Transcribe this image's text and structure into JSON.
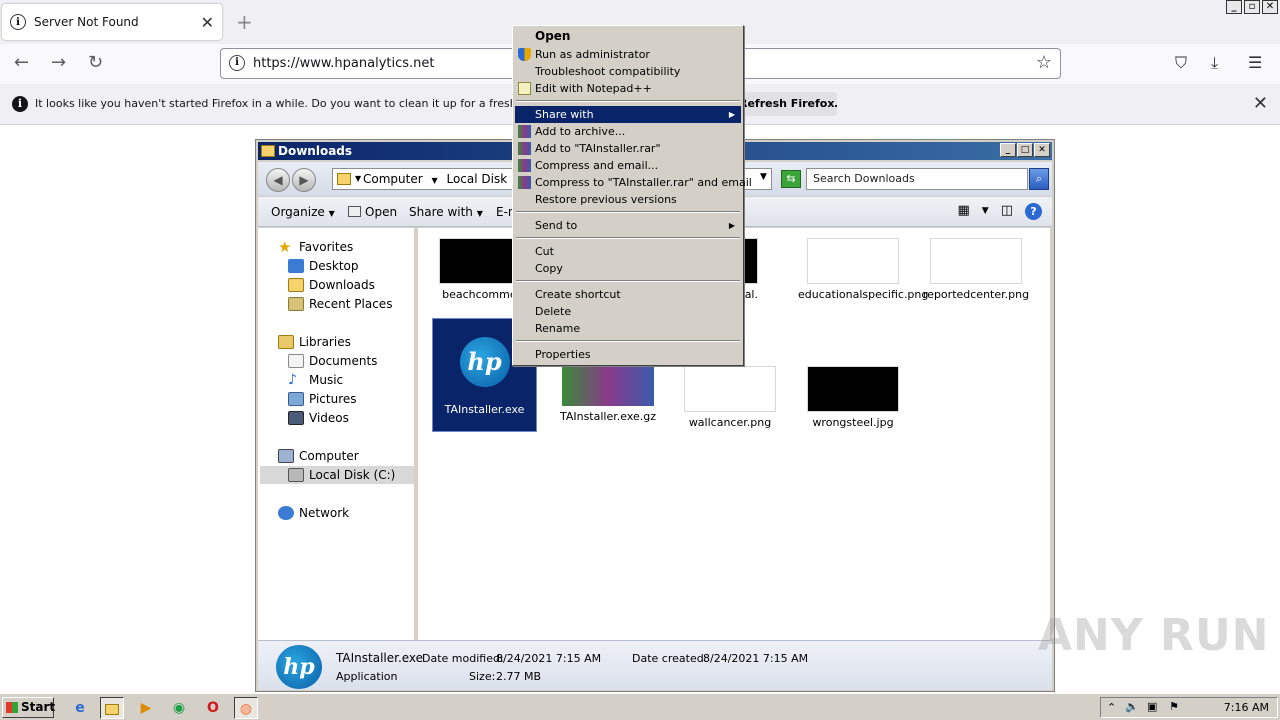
{
  "browser": {
    "tab_title": "Server Not Found",
    "url": "https://www.hpanalytics.net",
    "notification": "It looks like you haven't started Firefox in a while. Do you want to clean it up for a fresh, like-new e",
    "notification_button": "Refresh Firefox…"
  },
  "explorer": {
    "title": "Downloads",
    "breadcrumb": [
      "Computer",
      "Local Disk (C:)"
    ],
    "search_placeholder": "Search Downloads",
    "toolbar": {
      "organize": "Organize",
      "open": "Open",
      "share_with": "Share with",
      "email": "E-m"
    },
    "nav": {
      "favorites": "Favorites",
      "desktop": "Desktop",
      "downloads": "Downloads",
      "recent": "Recent Places",
      "libraries": "Libraries",
      "documents": "Documents",
      "music": "Music",
      "pictures": "Pictures",
      "videos": "Videos",
      "computer": "Computer",
      "local_disk": "Local Disk (C:)",
      "network": "Network"
    },
    "files": [
      {
        "name": "beachcomment"
      },
      {
        "name": "ternal."
      },
      {
        "name": "educationalspecific.png"
      },
      {
        "name": "reportedcenter.png"
      },
      {
        "name": "TAInstaller.exe"
      },
      {
        "name": "TAInstaller.exe.gz"
      },
      {
        "name": "wallcancer.png"
      },
      {
        "name": "wrongsteel.jpg"
      }
    ],
    "status": {
      "file_name": "TAInstaller.exe",
      "type": "Application",
      "modified_label": "Date modified:",
      "modified": "8/24/2021 7:15 AM",
      "created_label": "Date created:",
      "created": "8/24/2021 7:15 AM",
      "size_label": "Size:",
      "size": "2.77 MB"
    }
  },
  "context_menu": {
    "open": "Open",
    "run_admin": "Run as administrator",
    "troubleshoot": "Troubleshoot compatibility",
    "notepad": "Edit with Notepad++",
    "share_with": "Share with",
    "add_archive": "Add to archive...",
    "add_rar": "Add to \"TAInstaller.rar\"",
    "compress_email": "Compress and email...",
    "compress_rar_email": "Compress to \"TAInstaller.rar\" and email",
    "restore": "Restore previous versions",
    "send_to": "Send to",
    "cut": "Cut",
    "copy": "Copy",
    "create_shortcut": "Create shortcut",
    "delete": "Delete",
    "rename": "Rename",
    "properties": "Properties"
  },
  "taskbar": {
    "start": "Start",
    "clock": "7:16 AM"
  },
  "watermark": "ANY RUN",
  "colors": {
    "menu_highlight": "#0a246a",
    "title_bar": "#0a246a",
    "selection": "#0a246a"
  }
}
